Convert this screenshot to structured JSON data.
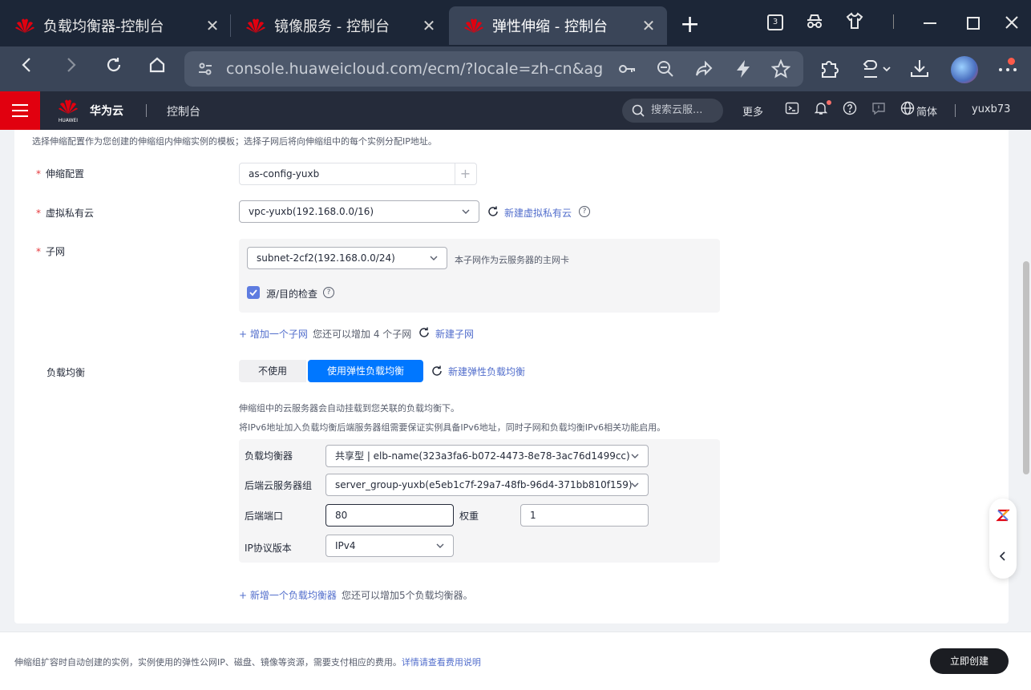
{
  "browser": {
    "tabs": [
      {
        "title": "负载均衡器-控制台",
        "active": false
      },
      {
        "title": "镜像服务 - 控制台",
        "active": false
      },
      {
        "title": "弹性伸缩 - 控制台",
        "active": true
      }
    ],
    "tab_close_glyph": "✕",
    "new_tab_glyph": "+",
    "tab_count": "3",
    "url": "console.huaweicloud.com/ecm/?locale=zh-cn&agen..."
  },
  "console_header": {
    "brand": "华为云",
    "logo_text": "HUAWEI",
    "console_label": "控制台",
    "search_placeholder": "搜索云服...",
    "more_label": "更多",
    "language_label": "简体",
    "username": "yuxb73"
  },
  "form": {
    "top_hint": "选择伸缩配置作为您创建的伸缩组内伸缩实例的模板；选择子网后将向伸缩组中的每个实例分配IP地址。",
    "required_mark": "*",
    "scaling_config": {
      "label": "伸缩配置",
      "value": "as-config-yuxb",
      "add_glyph": "+"
    },
    "vpc": {
      "label": "虚拟私有云",
      "value": "vpc-yuxb(192.168.0.0/16)",
      "create_link": "新建虚拟私有云"
    },
    "subnet": {
      "label": "子网",
      "value": "subnet-2cf2(192.168.0.0/24)",
      "primary_nic_hint": "本子网作为云服务器的主网卡",
      "source_dest_check_label": "源/目的检查",
      "source_dest_checked": true,
      "add_subnet_link": "+ 增加一个子网",
      "remaining_hint": "您还可以增加 4 个子网",
      "create_subnet_link": "新建子网"
    },
    "load_balance": {
      "label": "负载均衡",
      "option_off": "不使用",
      "option_on": "使用弹性负载均衡",
      "create_elb_link": "新建弹性负载均衡",
      "hint_1": "伸缩组中的云服务器会自动挂载到您关联的负载均衡下。",
      "hint_2": "将IPv6地址加入负载均衡后端服务器组需要保证实例具备IPv6地址，同时子网和负载均衡IPv6相关功能启用。",
      "lb_label": "负载均衡器",
      "lb_value": "共享型 | elb-name(323a3fa6-b072-4473-8e78-3ac76d1499cc)",
      "backend_group_label": "后端云服务器组",
      "backend_group_value": "server_group-yuxb(e5eb1c7f-29a7-48fb-96d4-371bb810f159)",
      "backend_port_label": "后端端口",
      "backend_port_value": "80",
      "weight_label": "权重",
      "weight_value": "1",
      "ip_version_label": "IP协议版本",
      "ip_version_value": "IPv4",
      "add_lb_link": "+ 新增一个负载均衡器",
      "add_lb_hint": "您还可以增加5个负载均衡器。"
    }
  },
  "footer": {
    "notice": "伸缩组扩容时自动创建的实例，实例使用的弹性公网IP、磁盘、镜像等资源，需要支付相应的费用。",
    "fee_link": "详情请查看费用说明",
    "create_button": "立即创建"
  },
  "colors": {
    "accent": "#0077ff",
    "link": "#526ecc",
    "brand_red": "#e1000f",
    "required": "#e6383c"
  }
}
